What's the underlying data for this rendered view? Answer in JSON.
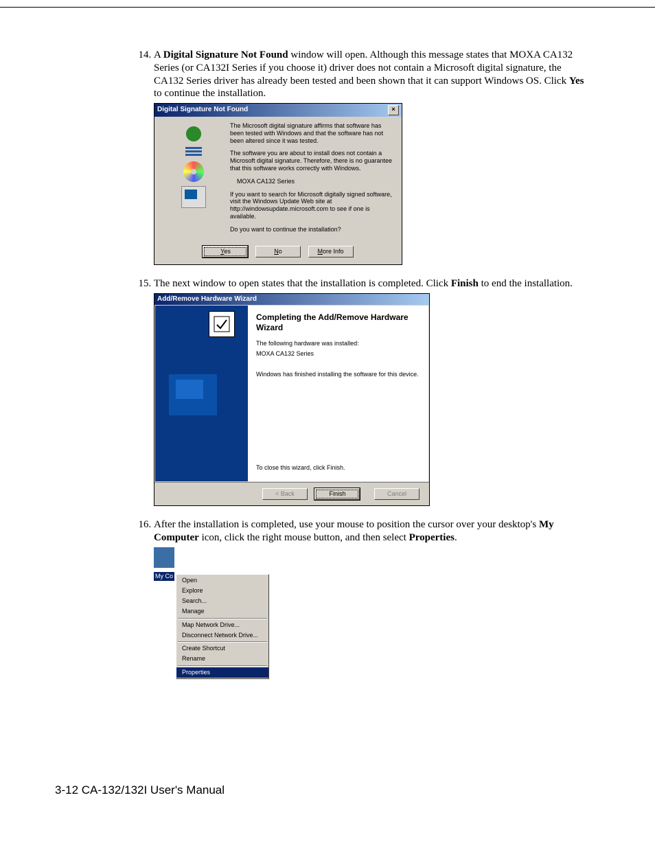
{
  "step14": {
    "num": "14.",
    "text_a": "A ",
    "bold1": "Digital Signature Not Found",
    "text_b": " window will open. Although this message states that MOXA CA132 Series (or CA132I Series if you choose it) driver does not contain a Microsoft digital signature, the CA132 Series driver has already been tested and been shown that it can support Windows OS. Click ",
    "bold2": "Yes",
    "text_c": " to continue the installation."
  },
  "dlg1": {
    "title": "Digital Signature Not Found",
    "p1": "The Microsoft digital signature affirms that software has been tested with Windows and that the software has not been altered since it was tested.",
    "p2": "The software you are about to install does not contain a Microsoft digital signature. Therefore, there is no guarantee that this software works correctly with Windows.",
    "product": "MOXA CA132 Series",
    "p3": "If you want to search for Microsoft digitally signed software, visit the Windows Update Web site at http://windowsupdate.microsoft.com to see if one is available.",
    "p4": "Do you want to continue the installation?",
    "btn_yes_u": "Y",
    "btn_yes": "es",
    "btn_no_u": "N",
    "btn_no": "o",
    "btn_more_u": "M",
    "btn_more": "ore Info"
  },
  "step15": {
    "text_a": "The next window to open states that the installation is completed. Click ",
    "bold1": "Finish",
    "text_b": " to end the installation."
  },
  "dlg2": {
    "title": "Add/Remove Hardware Wizard",
    "heading": "Completing the Add/Remove Hardware Wizard",
    "p1": "The following hardware was installed:",
    "product": "MOXA CA132 Series",
    "p2": "Windows has finished installing the software for this device.",
    "p3": "To close this wizard, click Finish.",
    "btn_back": "< Back",
    "btn_finish": "Finish",
    "btn_cancel": "Cancel"
  },
  "step16": {
    "text_a": "After the installation is completed, use your mouse to position the cursor over your desktop's ",
    "bold1": "My Computer",
    "text_b": " icon, click the right mouse button, and then select ",
    "bold2": "Properties",
    "text_c": "."
  },
  "ctx": {
    "label": "My Co",
    "items": {
      "open": "Open",
      "explore": "Explore",
      "search": "Search...",
      "manage": "Manage",
      "map": "Map Network Drive...",
      "disc": "Disconnect Network Drive...",
      "shortcut": "Create Shortcut",
      "rename": "Rename",
      "properties": "Properties"
    }
  },
  "footer": "3-12  CA-132/132I User's Manual"
}
